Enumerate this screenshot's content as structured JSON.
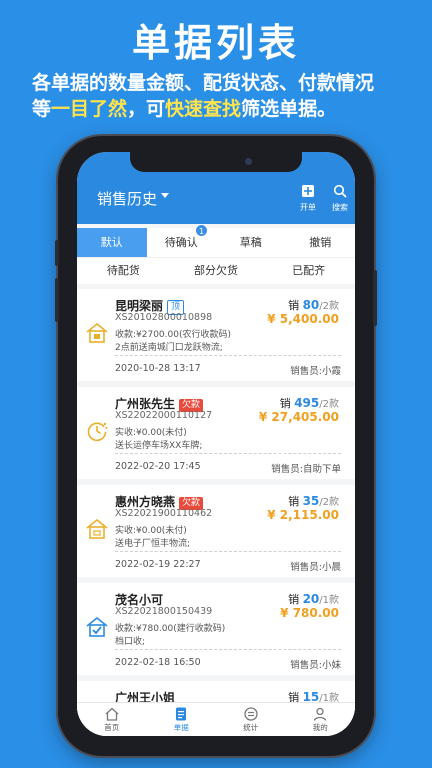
{
  "promo": {
    "headline": "单据列表",
    "line1": "各单据的数量金额、配货状态、付款情况",
    "line2_pre": "等",
    "line2_hl1": "一目了然",
    "line2_mid": "，可",
    "line2_hl2": "快速查找",
    "line2_post": "筛选单据。"
  },
  "appbar": {
    "title": "销售历史",
    "action_new": "开单",
    "action_search": "搜索"
  },
  "tabs": [
    {
      "label": "默认",
      "active": true
    },
    {
      "label": "待确认",
      "badge": "1"
    },
    {
      "label": "草稿"
    },
    {
      "label": "撤销"
    }
  ],
  "subtabs": [
    "待配货",
    "部分欠货",
    "已配齐"
  ],
  "orders": [
    {
      "name": "昆明梁丽",
      "tag": "顶",
      "no": "XS20102800010898",
      "line1": "收款:¥2700.00(农行收款码)",
      "line2": "2点前送南城门口龙跃物流;",
      "qty_prefix": "销",
      "qty": "80",
      "qty_unit": "/2款",
      "amount": "¥ 5,400.00",
      "time": "2020-10-28 13:17",
      "seller": "销售员:小霞"
    },
    {
      "name": "广州张先生",
      "tag": "欠款",
      "no": "XS22022000110127",
      "line1": "实收:¥0.00(未付)",
      "line2": "送长运停车场XX车牌;",
      "qty_prefix": "销",
      "qty": "495",
      "qty_unit": "/2款",
      "amount": "¥ 27,405.00",
      "time": "2022-02-20 17:45",
      "seller": "销售员:自助下单"
    },
    {
      "name": "惠州方晓燕",
      "tag": "欠款",
      "no": "XS22021900110462",
      "line1": "实收:¥0.00(未付)",
      "line2": "送电子厂恒丰物流;",
      "qty_prefix": "销",
      "qty": "35",
      "qty_unit": "/2款",
      "amount": "¥ 2,115.00",
      "time": "2022-02-19 22:27",
      "seller": "销售员:小晨"
    },
    {
      "name": "茂名小可",
      "tag": "",
      "no": "XS22021800150439",
      "line1": "收款:¥780.00(建行收款码)",
      "line2": "档口收;",
      "qty_prefix": "销",
      "qty": "20",
      "qty_unit": "/1款",
      "amount": "¥ 780.00",
      "time": "2022-02-18 16:50",
      "seller": "销售员:小妹"
    },
    {
      "name": "广州王小姐",
      "tag": "",
      "no": "",
      "line1": "",
      "line2": "",
      "qty_prefix": "销",
      "qty": "15",
      "qty_unit": "/1款",
      "amount": "",
      "time": "",
      "seller": ""
    }
  ],
  "bottombar": [
    "首页",
    "单据",
    "统计",
    "我的"
  ],
  "colors": {
    "brand": "#2b8ae0",
    "accent_amount": "#f0a020",
    "owe_tag": "#e84a3c",
    "promo_highlight": "#ffe34d"
  }
}
